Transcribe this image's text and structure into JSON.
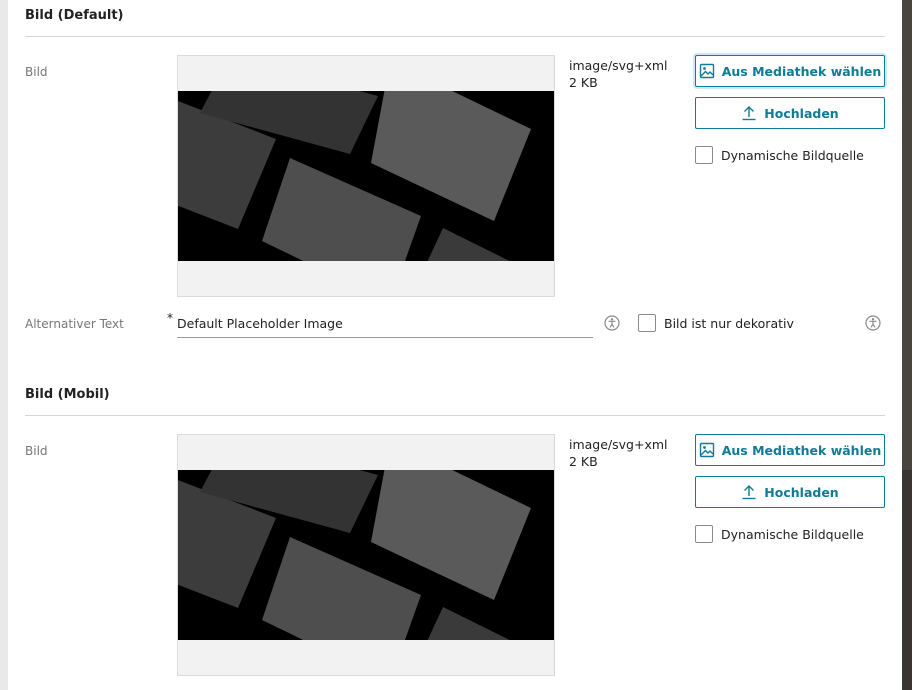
{
  "sections": [
    {
      "title": "Bild (Default)",
      "image_label": "Bild",
      "image_type": "image/svg+xml",
      "image_size": "2 KB",
      "media_button": "Aus Mediathek wählen",
      "upload_button": "Hochladen",
      "dynamic_source_label": "Dynamische Bildquelle",
      "alt_text_label": "Alternativer Text",
      "alt_text_required": "*",
      "alt_text_value": "Default Placeholder Image",
      "decorative_label": "Bild ist nur dekorativ"
    },
    {
      "title": "Bild (Mobil)",
      "image_label": "Bild",
      "image_type": "image/svg+xml",
      "image_size": "2 KB",
      "media_button": "Aus Mediathek wählen",
      "upload_button": "Hochladen",
      "dynamic_source_label": "Dynamische Bildquelle"
    }
  ],
  "icons": {
    "media": "image-icon",
    "upload": "upload-icon",
    "accessibility": "accessibility-icon"
  },
  "colors": {
    "accent": "#0f7b96"
  }
}
